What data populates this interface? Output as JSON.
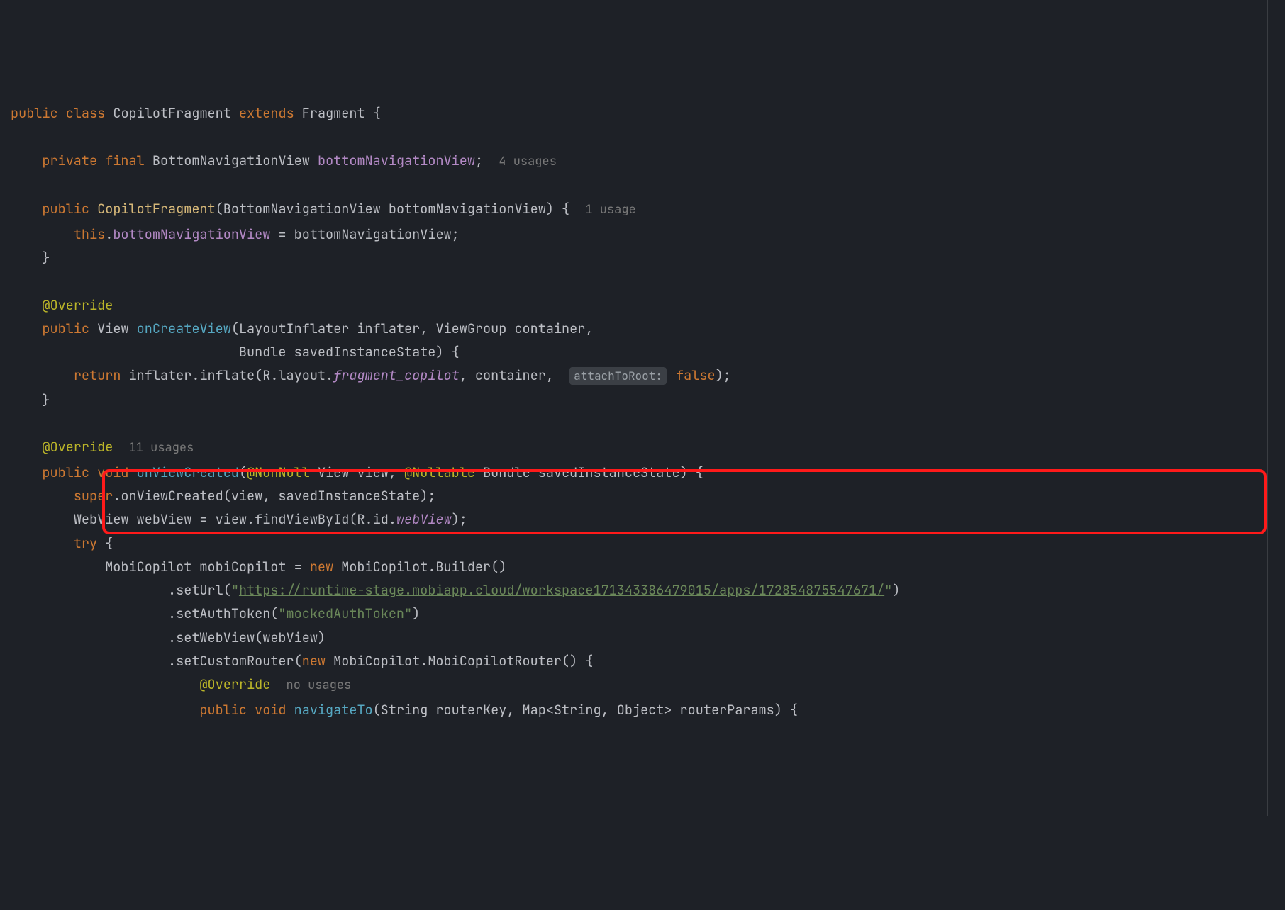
{
  "code": {
    "line1": {
      "public": "public",
      "class": "class",
      "classname": "CopilotFragment",
      "extends": "extends",
      "parent": "Fragment",
      "brace": " {"
    },
    "line3": {
      "private": "private",
      "final": "final",
      "type": "BottomNavigationView",
      "field": "bottomNavigationView",
      "semi": ";",
      "usage": "4 usages"
    },
    "line5": {
      "public": "public",
      "constructor": "CopilotFragment",
      "params": "(BottomNavigationView bottomNavigationView) {",
      "usage": "1 usage"
    },
    "line6": {
      "this": "this",
      "dot": ".",
      "field": "bottomNavigationView",
      "rest": " = bottomNavigationView;"
    },
    "line7": {
      "brace": "}"
    },
    "line9": {
      "annotation": "@Override"
    },
    "line10": {
      "public": "public",
      "ret": "View",
      "method": "onCreateView",
      "params": "(LayoutInflater inflater, ViewGroup container,"
    },
    "line11": {
      "params": "Bundle savedInstanceState) {"
    },
    "line12": {
      "return": "return",
      "pre": " inflater.inflate(R.layout.",
      "field": "fragment_copilot",
      "post1": ", container, ",
      "hint": "attachToRoot:",
      "post2": " ",
      "false": "false",
      "post3": ");"
    },
    "line13": {
      "brace": "}"
    },
    "line15": {
      "annotation": "@Override",
      "usage": "11 usages"
    },
    "line16": {
      "public": "public",
      "void": "void",
      "method": "onViewCreated",
      "p1": "(",
      "a1": "@NonNull",
      "p2": " View view, ",
      "a2": "@Nullable",
      "p3": " Bundle savedInstanceState) {"
    },
    "line17": {
      "super": "super",
      "rest": ".onViewCreated(view, savedInstanceState);"
    },
    "line18": {
      "pre": "WebView webView = view.findViewById(R.id.",
      "field": "webView",
      "post": ");"
    },
    "line19": {
      "try": "try",
      "brace": " {"
    },
    "line20": {
      "pre": "MobiCopilot mobiCopilot = ",
      "new": "new",
      "post": " MobiCopilot.Builder()"
    },
    "line21": {
      "pre": ".setUrl(",
      "q1": "\"",
      "url": "https://runtime-stage.mobiapp.cloud/workspace171343386479015/apps/172854875547671/",
      "q2": "\"",
      "post": ")"
    },
    "line22": {
      "pre": ".setAuthToken(",
      "str": "\"mockedAuthToken\"",
      "post": ")"
    },
    "line23": {
      "text": ".setWebView(webView)"
    },
    "line24": {
      "pre": ".setCustomRouter(",
      "new": "new",
      "post": " MobiCopilot.MobiCopilotRouter() {"
    },
    "line25": {
      "annotation": "@Override",
      "usage": "no usages"
    },
    "line26": {
      "public": "public",
      "void": "void",
      "method": "navigateTo",
      "params": "(String routerKey, Map<String, Object> routerParams) {"
    }
  }
}
